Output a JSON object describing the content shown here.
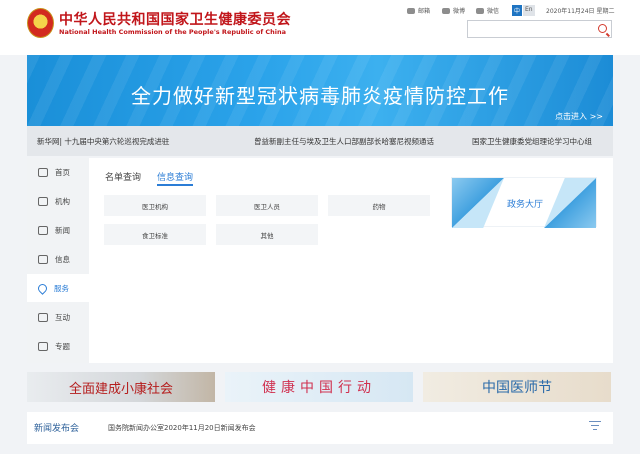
{
  "header": {
    "title": "中华人民共和国国家卫生健康委员会",
    "subtitle": "National Health Commission of the People's Republic of China",
    "social": {
      "mail": "邮箱",
      "weibo": "微博",
      "wechat": "微信"
    },
    "lang": {
      "zh": "中",
      "en": "En"
    },
    "date": "2020年11月24日 星期二",
    "search_placeholder": ""
  },
  "banner": {
    "title": "全力做好新型冠状病毒肺炎疫情防控工作",
    "link": "点击进入 >>"
  },
  "ticker": [
    "新华网| 十九届中央第六轮巡视完成进驻",
    "曾益新副主任与埃及卫生人口部副部长哈塞尼视频通话",
    "国家卫生健康委党组理论学习中心组"
  ],
  "sidebar": {
    "items": [
      {
        "label": "首页",
        "icon": "home-icon"
      },
      {
        "label": "机构",
        "icon": "org-icon"
      },
      {
        "label": "新闻",
        "icon": "news-icon"
      },
      {
        "label": "信息",
        "icon": "info-icon"
      },
      {
        "label": "服务",
        "icon": "heart-icon"
      },
      {
        "label": "互动",
        "icon": "chat-icon"
      },
      {
        "label": "专题",
        "icon": "tag-icon"
      }
    ],
    "active": "服务"
  },
  "tabs": [
    {
      "label": "名单查询"
    },
    {
      "label": "信息查询"
    }
  ],
  "active_tab": "信息查询",
  "query_buttons": [
    {
      "label": "医卫机构"
    },
    {
      "label": "医卫人员"
    },
    {
      "label": "药物"
    },
    {
      "label": "食卫标准"
    },
    {
      "label": "其他"
    }
  ],
  "gov_hall": {
    "label": "政务大厅"
  },
  "promos": [
    {
      "text": "全面建成小康社会"
    },
    {
      "text": "健康中国行动"
    },
    {
      "text": "中国医师节"
    }
  ],
  "press": {
    "title": "新闻发布会",
    "item": "国务院新闻办公室2020年11月20日新闻发布会"
  }
}
